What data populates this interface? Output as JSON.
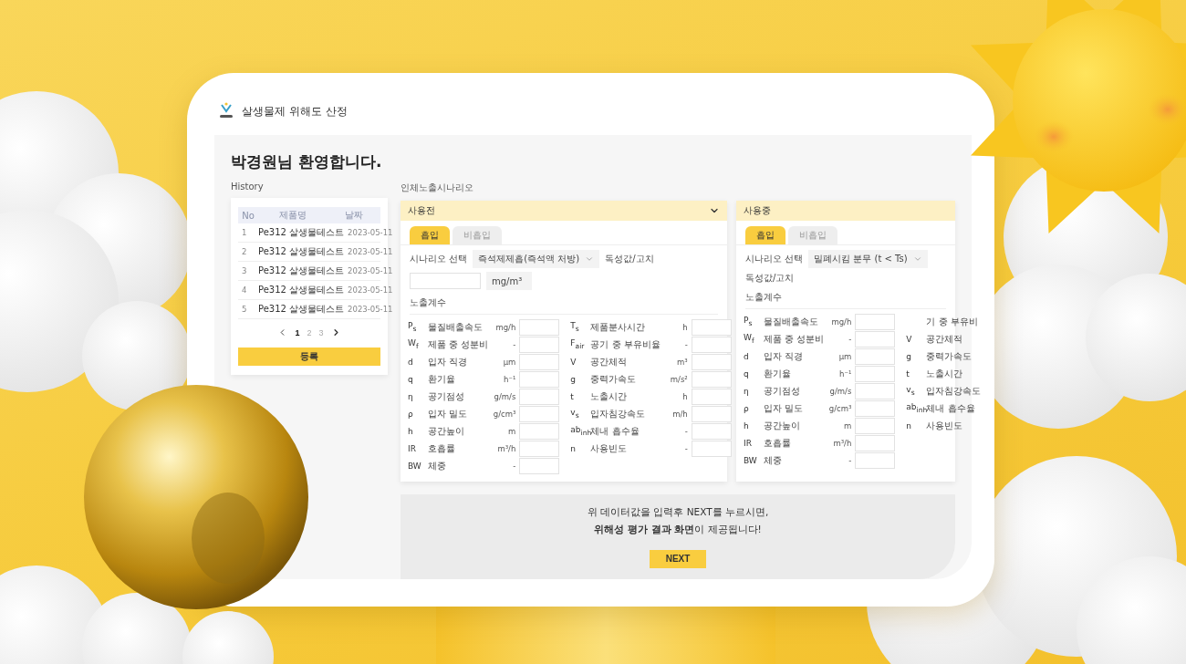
{
  "app": {
    "title": "살생물제 위해도 산정"
  },
  "welcome": "박경원님 환영합니다.",
  "history": {
    "title": "History",
    "columns": [
      "No",
      "제품명",
      "날짜"
    ],
    "rows": [
      {
        "no": "1",
        "name": "Pe312 살생물테스트",
        "date": "2023-05-11"
      },
      {
        "no": "2",
        "name": "Pe312 살생물테스트",
        "date": "2023-05-11"
      },
      {
        "no": "3",
        "name": "Pe312 살생물테스트",
        "date": "2023-05-11"
      },
      {
        "no": "4",
        "name": "Pe312 살생물테스트",
        "date": "2023-05-11"
      },
      {
        "no": "5",
        "name": "Pe312 살생물테스트",
        "date": "2023-05-11"
      }
    ],
    "pages": [
      {
        "label": "1",
        "selected": true
      },
      {
        "label": "2",
        "selected": false
      },
      {
        "label": "3",
        "selected": false
      }
    ],
    "button": "등록"
  },
  "scenario": {
    "title": "인체노출시나리오",
    "panels": [
      {
        "title": "사용전",
        "expanded": true,
        "tabs": [
          {
            "label": "흡입",
            "selected": true
          },
          {
            "label": "비흡입",
            "selected": false
          }
        ],
        "scenario_label": "시나리오 선택",
        "scenario_value": "즉석제제흡(즉석액 처방)",
        "toxicity_label": "독성값/고치",
        "toxicity_unit": "mg/m³",
        "coef_label": "노출계수",
        "columns": [
          [
            {
              "symbol": "P$_{s}$",
              "label": "물질배출속도",
              "unit": "mg/h"
            },
            {
              "symbol": "W$_{f}$",
              "label": "제품 중 성분비",
              "unit": "-"
            },
            {
              "symbol": "d",
              "label": "입자 직경",
              "unit": "μm"
            },
            {
              "symbol": "q",
              "label": "환기율",
              "unit": "h⁻¹"
            },
            {
              "symbol": "η",
              "label": "공기점성",
              "unit": "g/m/s"
            },
            {
              "symbol": "ρ",
              "label": "입자 밀도",
              "unit": "g/cm³"
            },
            {
              "symbol": "h",
              "label": "공간높이",
              "unit": "m"
            },
            {
              "symbol": "IR",
              "label": "호흡률",
              "unit": "m³/h"
            },
            {
              "symbol": "BW",
              "label": "체중",
              "unit": "-"
            }
          ],
          [
            {
              "symbol": "T$_{s}$",
              "label": "제품분사시간",
              "unit": "h"
            },
            {
              "symbol": "F$_{air}$",
              "label": "공기 중 부유비율",
              "unit": "-"
            },
            {
              "symbol": "V",
              "label": "공간체적",
              "unit": "m³"
            },
            {
              "symbol": "g",
              "label": "중력가속도",
              "unit": "m/s²"
            },
            {
              "symbol": "t",
              "label": "노출시간",
              "unit": "h"
            },
            {
              "symbol": "v$_{s}$",
              "label": "입자침강속도",
              "unit": "m/h"
            },
            {
              "symbol": "ab$_{inh}$",
              "label": "체내 흡수율",
              "unit": "-"
            },
            {
              "symbol": "n",
              "label": "사용빈도",
              "unit": "-"
            }
          ]
        ]
      },
      {
        "title": "사용중",
        "tabs": [
          {
            "label": "흡입",
            "selected": true
          },
          {
            "label": "비흡입",
            "selected": false
          }
        ],
        "scenario_label": "시나리오 선택",
        "scenario_value": "밀폐시킴 분무 (t < Ts)",
        "toxicity_label": "독성값/고치",
        "coef_label": "노출계수",
        "columns": [
          [
            {
              "symbol": "P$_{s}$",
              "label": "물질배출속도",
              "unit": "mg/h"
            },
            {
              "symbol": "W$_{f}$",
              "label": "제품 중 성분비",
              "unit": "-"
            },
            {
              "symbol": "d",
              "label": "입자 직경",
              "unit": "μm"
            },
            {
              "symbol": "q",
              "label": "환기율",
              "unit": "h⁻¹"
            },
            {
              "symbol": "η",
              "label": "공기점성",
              "unit": "g/m/s"
            },
            {
              "symbol": "ρ",
              "label": "입자 밀도",
              "unit": "g/cm³"
            },
            {
              "symbol": "h",
              "label": "공간높이",
              "unit": "m"
            },
            {
              "symbol": "IR",
              "label": "호흡률",
              "unit": "m³/h"
            },
            {
              "symbol": "BW",
              "label": "체중",
              "unit": "-"
            }
          ],
          [
            {
              "label": "기 중 부유비"
            },
            {
              "symbol": "V",
              "label": "공간체적"
            },
            {
              "symbol": "g",
              "label": "중력가속도"
            },
            {
              "symbol": "t",
              "label": "노출시간"
            },
            {
              "symbol": "v$_{s}$",
              "label": "입자침강속도"
            },
            {
              "symbol": "ab$_{inh}$",
              "label": "체내 흡수율"
            },
            {
              "symbol": "n",
              "label": "사용빈도"
            }
          ]
        ]
      }
    ]
  },
  "notice": {
    "lines": [
      "위 데이터값을 입력후 NEXT를 누르시면,",
      "**위해성 평가 결과 화면**이 제공됩니다!"
    ],
    "button": "NEXT"
  }
}
